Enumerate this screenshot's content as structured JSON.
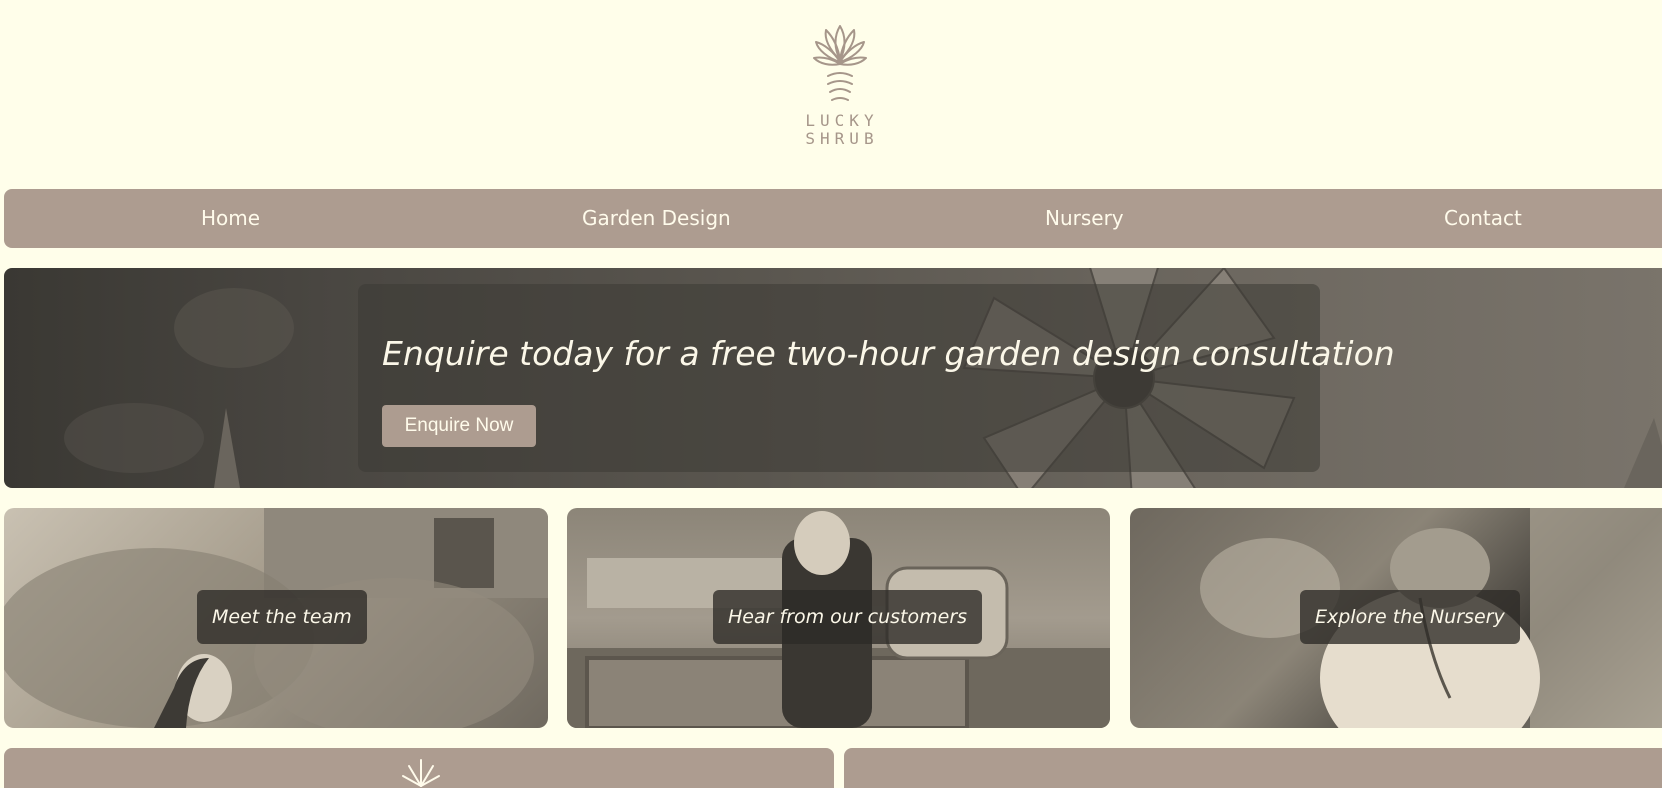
{
  "brand": {
    "line1": "LUCKY",
    "line2": "SHRUB"
  },
  "nav": {
    "items": [
      {
        "label": "Home"
      },
      {
        "label": "Garden Design"
      },
      {
        "label": "Nursery"
      },
      {
        "label": "Contact"
      }
    ]
  },
  "hero": {
    "headline": "Enquire today for a free two-hour garden design consultation",
    "button_label": "Enquire Now"
  },
  "cards": [
    {
      "label": "Meet the team"
    },
    {
      "label": "Hear from our customers"
    },
    {
      "label": "Explore the Nursery"
    }
  ],
  "colors": {
    "background": "#fffeea",
    "accent": "#ad9c90",
    "panel": "#3c3a35",
    "text_light": "#fffbeb"
  },
  "icons": [
    "shrub-logo-icon"
  ]
}
